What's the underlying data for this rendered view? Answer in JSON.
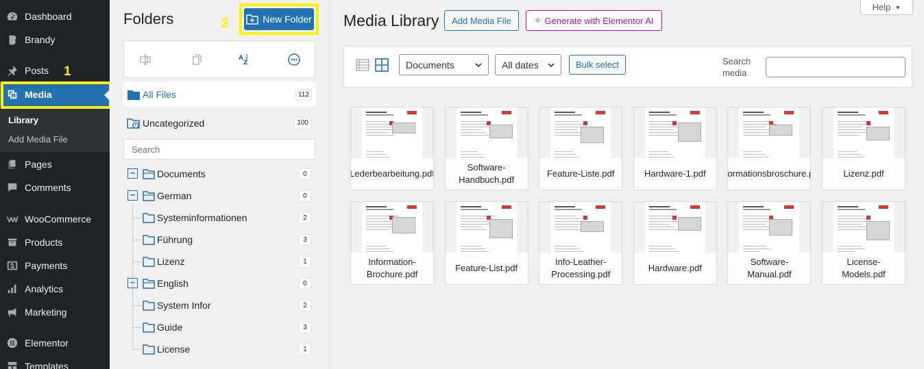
{
  "sidebar": {
    "items": [
      {
        "label": "Dashboard",
        "icon": "dashboard-icon"
      },
      {
        "label": "Brandy",
        "icon": "brandy-icon"
      },
      {
        "label": "Posts",
        "icon": "pin-icon"
      },
      {
        "label": "Media",
        "icon": "media-icon"
      },
      {
        "label": "Pages",
        "icon": "pages-icon"
      },
      {
        "label": "Comments",
        "icon": "comments-icon"
      },
      {
        "label": "WooCommerce",
        "icon": "woocommerce-icon"
      },
      {
        "label": "Products",
        "icon": "archive-icon"
      },
      {
        "label": "Payments",
        "icon": "dollar-icon"
      },
      {
        "label": "Analytics",
        "icon": "bar-chart-icon"
      },
      {
        "label": "Marketing",
        "icon": "megaphone-icon"
      },
      {
        "label": "Elementor",
        "icon": "elementor-icon"
      },
      {
        "label": "Templates",
        "icon": "templates-icon"
      }
    ],
    "submenu": [
      "Library",
      "Add Media File"
    ],
    "step_marker": "1"
  },
  "folders": {
    "title": "Folders",
    "new_folder_label": "New Folder",
    "step_marker": "2",
    "all_files": {
      "label": "All Files",
      "count": "112"
    },
    "uncategorized": {
      "label": "Uncategorized",
      "count": "100"
    },
    "search_placeholder": "Search",
    "tree": [
      {
        "label": "Documents",
        "count": "0"
      },
      {
        "label": "German",
        "count": "0"
      },
      {
        "label": "Systeminformationen",
        "count": "2"
      },
      {
        "label": "Führung",
        "count": "3"
      },
      {
        "label": "Lizenz",
        "count": "1"
      },
      {
        "label": "English",
        "count": "0"
      },
      {
        "label": "System Infor",
        "count": "2"
      },
      {
        "label": "Guide",
        "count": "3"
      },
      {
        "label": "License",
        "count": "1"
      }
    ]
  },
  "main": {
    "help_label": "Help",
    "title": "Media Library",
    "add_media_label": "Add Media File",
    "elementor_ai_label": "Generate with Elementor AI",
    "filter_type": "Documents",
    "filter_date": "All dates",
    "bulk_select_label": "Bulk select",
    "search_label": "Search media",
    "files": [
      "Lederbearbeitung.pdf",
      "Software-Handbuch.pdf",
      "Feature-Liste.pdf",
      "Hardware-1.pdf",
      "Informationsbroschure.pdf",
      "Lizenz.pdf",
      "Information-Brochure.pdf",
      "Feature-List.pdf",
      "Info-Leather-Processing.pdf",
      "Hardware.pdf",
      "Software-Manual.pdf",
      "License-Models.pdf"
    ]
  },
  "colors": {
    "sidebar_bg": "#1d2327",
    "accent": "#2271b1",
    "highlight": "#fff200",
    "elementor": "#c00bb4"
  }
}
